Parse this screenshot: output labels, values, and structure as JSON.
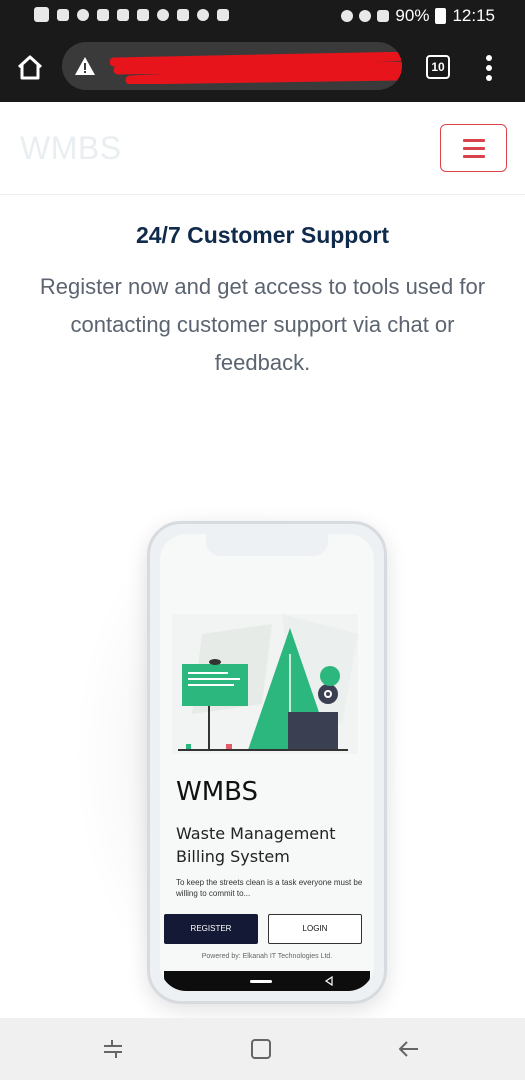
{
  "status_bar": {
    "battery": "90%",
    "time": "12:15"
  },
  "browser": {
    "tab_count": "10"
  },
  "site": {
    "brand": "WMBS",
    "menu_icon": "hamburger-icon"
  },
  "section": {
    "heading": "24/7 Customer Support",
    "paragraph": "Register now and get access to tools used for contacting customer support via chat or feedback."
  },
  "phone_mockup": {
    "app_title": "WMBS",
    "app_subtitle": "Waste Management Billing System",
    "app_description": "To keep the streets clean is a task everyone must be willing to commit to...",
    "register_label": "REGISTER",
    "login_label": "LOGIN",
    "powered_by": "Powered by: Elkanah IT Technologies Ltd."
  },
  "colors": {
    "accent_red": "#d9434c",
    "heading_navy": "#0f2a4a",
    "illustration_green": "#2bb77e",
    "button_dark": "#141a35"
  }
}
